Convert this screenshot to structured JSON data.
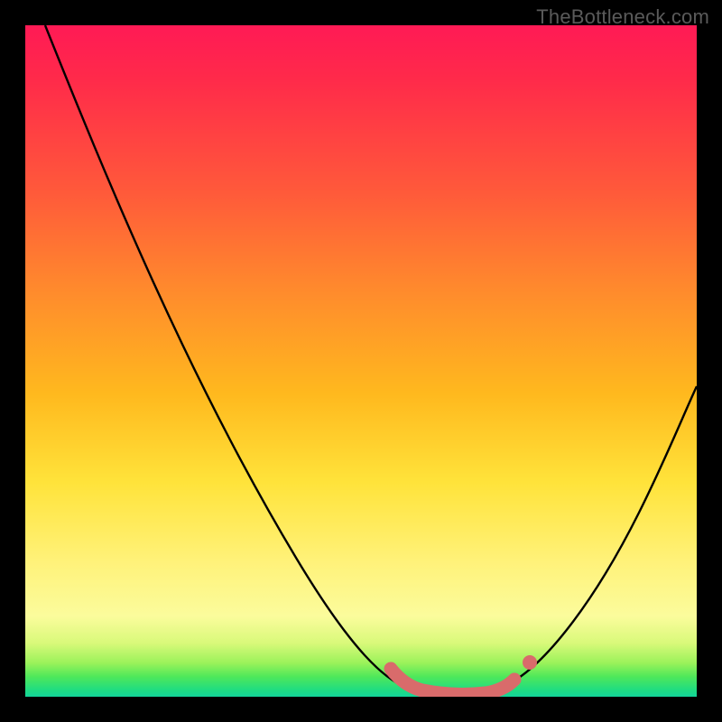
{
  "watermark": "TheBottleneck.com",
  "colors": {
    "frame": "#000000",
    "curve": "#000000",
    "highlight": "#d96b6b",
    "gradient_top": "#ff1a55",
    "gradient_bottom": "#13d59b"
  },
  "chart_data": {
    "type": "line",
    "title": "",
    "xlabel": "",
    "ylabel": "",
    "xlim": [
      0,
      100
    ],
    "ylim": [
      0,
      100
    ],
    "grid": false,
    "legend": false,
    "series": [
      {
        "name": "bottleneck-curve",
        "x": [
          3,
          10,
          18,
          26,
          34,
          42,
          48,
          53,
          57,
          60,
          63,
          66,
          70,
          75,
          80,
          86,
          92,
          100
        ],
        "values": [
          100,
          86,
          71,
          56,
          42,
          28,
          17,
          9,
          4,
          2,
          1,
          1,
          2,
          5,
          11,
          20,
          31,
          46
        ]
      }
    ],
    "annotations": [
      {
        "name": "flat-bottom-highlight",
        "type": "segment",
        "x_start": 55,
        "x_end": 72,
        "style": "thick-pink"
      }
    ]
  }
}
